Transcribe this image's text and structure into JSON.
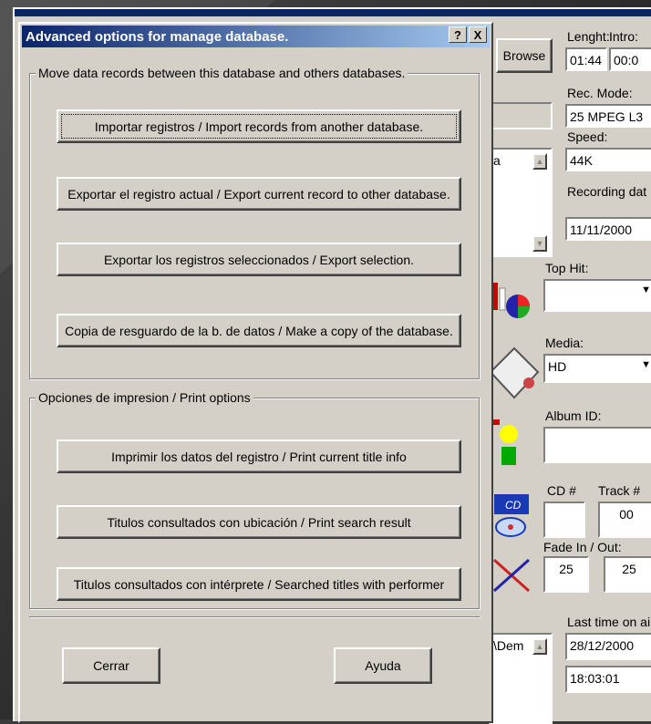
{
  "background": {
    "app": {
      "browse_label": "Browse",
      "length_label": "Lenght:",
      "intro_label": "Intro:",
      "length_value": "01:44",
      "intro_value": "00:0",
      "rec_mode_label": "Rec. Mode:",
      "rec_mode_value": "25 MPEG L3",
      "speed_label": "Speed:",
      "speed_value": "44K",
      "recording_date_label": "Recording dat",
      "recording_date_value": "11/11/2000",
      "list_fragment": "a",
      "top_hit_label": "Top Hit:",
      "top_hit_value": "",
      "media_label": "Media:",
      "media_value": "HD",
      "album_id_label": "Album ID:",
      "album_id_value": "",
      "cd_label": "CD #",
      "track_label": "Track #",
      "cd_value": "",
      "track_value": "00",
      "fade_label": "Fade In / Out:",
      "fade_in_value": "25",
      "fade_out_value": "25",
      "last_time_label": "Last time on ai",
      "last_date_value": "28/12/2000",
      "last_time_value": "18:03:01",
      "path_fragment": "\\Dem"
    }
  },
  "dialog": {
    "title": "Advanced options for manage database.",
    "help_button": "?",
    "close_button": "X",
    "group_move": {
      "legend": "Move data records between  this database and others databases.",
      "buttons": [
        "Importar registros  / Import records from another database.",
        "Exportar el registro actual / Export current record to other database.",
        "Exportar los registros seleccionados / Export selection.",
        "Copia de resguardo de la b. de datos / Make a copy of the database."
      ]
    },
    "group_print": {
      "legend": "Opciones de impresion / Print options",
      "buttons": [
        "Imprimir los datos del registro / Print current title info",
        "Titulos consultados con ubicación / Print search result",
        "Titulos consultados con intérprete / Searched titles with performer"
      ]
    },
    "close_label": "Cerrar",
    "help_label": "Ayuda"
  },
  "colors": {
    "title_start": "#0a246a",
    "title_end": "#a6caf0",
    "face": "#d4d0c8"
  }
}
